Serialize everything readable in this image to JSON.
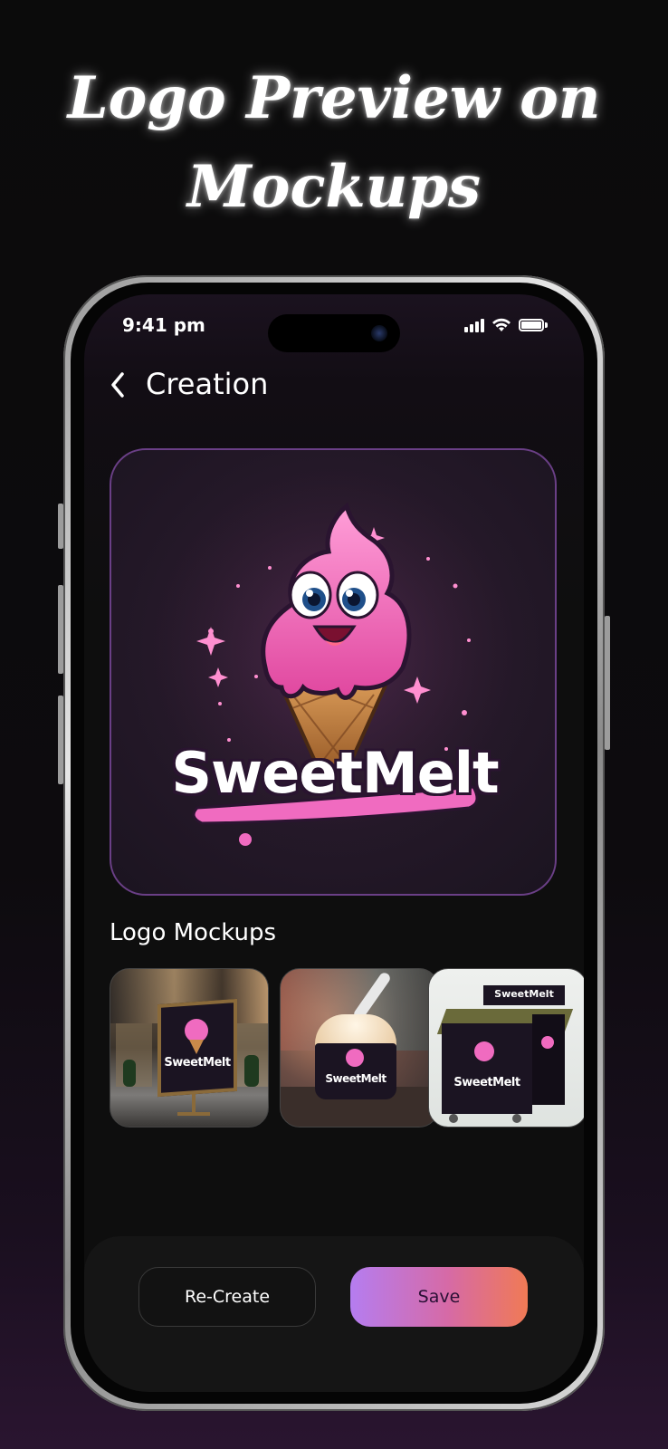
{
  "headline": {
    "line1": "Logo Preview on",
    "line2": "Mockups"
  },
  "status_bar": {
    "time": "9:41 pm"
  },
  "nav": {
    "title": "Creation"
  },
  "logo": {
    "brand_text": "SweetMelt"
  },
  "mockups_section": {
    "title": "Logo Mockups",
    "items": [
      {
        "name": "storefront-sign",
        "brand_text": "SweetMelt"
      },
      {
        "name": "ice-cream-cup",
        "brand_text": "SweetMelt"
      },
      {
        "name": "freezer-cart",
        "brand_text": "SweetMelt",
        "top_text": "SweetMelt"
      }
    ]
  },
  "actions": {
    "recreate_label": "Re-Create",
    "save_label": "Save"
  },
  "colors": {
    "accent_purple": "#b57df0",
    "accent_orange": "#f07a55",
    "logo_pink": "#f06bc0",
    "card_border": "#6a3f86"
  }
}
